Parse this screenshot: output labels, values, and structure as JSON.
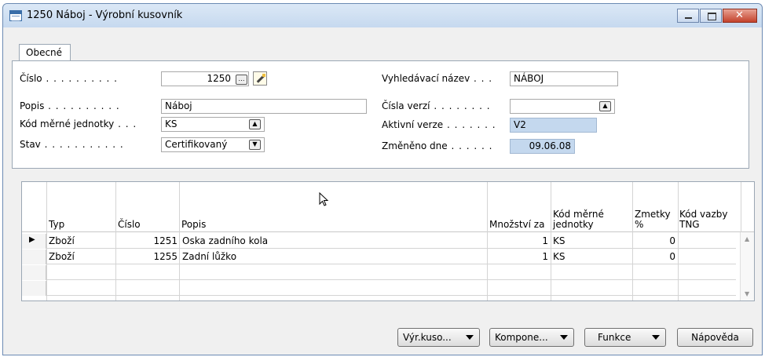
{
  "window": {
    "title": "1250 Náboj - Výrobní kusovník"
  },
  "tabs": [
    {
      "label": "Obecné"
    }
  ],
  "form": {
    "cislo": {
      "label": "Číslo",
      "value": "1250"
    },
    "popis": {
      "label": "Popis",
      "value": "Náboj"
    },
    "kod_jednotky": {
      "label": "Kód měrné jednotky",
      "value": "KS"
    },
    "stav": {
      "label": "Stav",
      "value": "Certifikovaný"
    },
    "vyhledavaci_nazev": {
      "label": "Vyhledávací název",
      "value": "NÁBOJ"
    },
    "cisla_verzi": {
      "label": "Čísla verzí",
      "value": ""
    },
    "aktivni_verze": {
      "label": "Aktivní verze",
      "value": "V2"
    },
    "zmeneno_dne": {
      "label": "Změněno dne",
      "value": "09.06.08"
    }
  },
  "grid": {
    "columns": [
      {
        "label": "Typ"
      },
      {
        "label": "Číslo"
      },
      {
        "label": "Popis"
      },
      {
        "label": "Množství za"
      },
      {
        "label_line1": "Kód měrné",
        "label_line2": "jednotky"
      },
      {
        "label_line1": "Zmetky",
        "label_line2": "%"
      },
      {
        "label_line1": "Kód vazby",
        "label_line2": "TNG"
      }
    ],
    "rows": [
      {
        "typ": "Zboží",
        "cislo": "1251",
        "popis": "Oska zadního kola",
        "mnozstvi": "1",
        "jednotka": "KS",
        "zmetky": "0",
        "vazba": ""
      },
      {
        "typ": "Zboží",
        "cislo": "1255",
        "popis": "Zadní lůžko",
        "mnozstvi": "1",
        "jednotka": "KS",
        "zmetky": "0",
        "vazba": ""
      }
    ]
  },
  "buttons": {
    "vyr_kuso": "Výr.kuso...",
    "kompone": "Kompone...",
    "funkce": "Funkce",
    "napoveda": "Nápověda"
  },
  "colors": {
    "readonly_field": "#c4d8ee",
    "titlebar": "#c6d9ef",
    "close_button": "#c4422c"
  }
}
